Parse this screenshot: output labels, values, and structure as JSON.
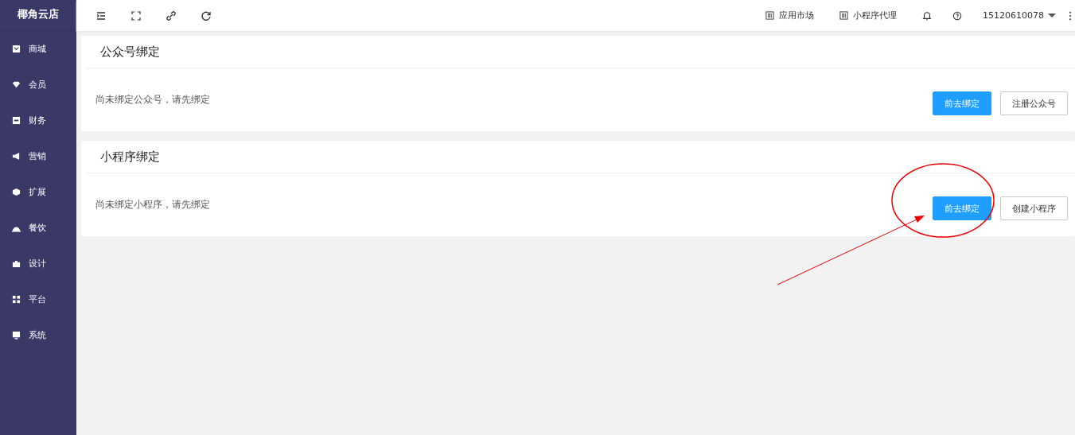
{
  "sidebar": {
    "logo": "椰角云店",
    "items": [
      {
        "label": "商城"
      },
      {
        "label": "会员"
      },
      {
        "label": "财务"
      },
      {
        "label": "营销"
      },
      {
        "label": "扩展"
      },
      {
        "label": "餐饮"
      },
      {
        "label": "设计"
      },
      {
        "label": "平台"
      },
      {
        "label": "系统"
      }
    ]
  },
  "topbar": {
    "links": [
      {
        "label": "应用市场"
      },
      {
        "label": "小程序代理"
      }
    ],
    "user": "15120610078"
  },
  "cards": [
    {
      "title": "公众号绑定",
      "message": "尚未绑定公众号，请先绑定",
      "buttons": [
        {
          "label": "前去绑定",
          "kind": "primary"
        },
        {
          "label": "注册公众号",
          "kind": "default"
        }
      ]
    },
    {
      "title": "小程序绑定",
      "message": "尚未绑定小程序，请先绑定",
      "buttons": [
        {
          "label": "前去绑定",
          "kind": "primary"
        },
        {
          "label": "创建小程序",
          "kind": "default"
        }
      ]
    }
  ]
}
